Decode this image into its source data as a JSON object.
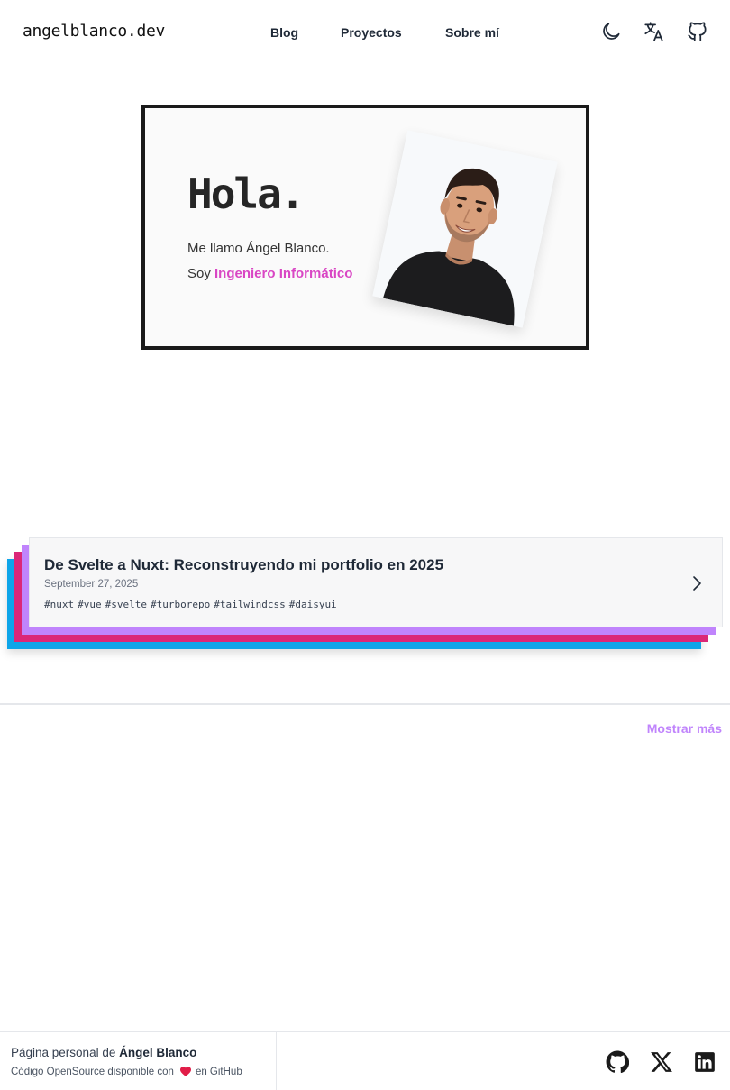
{
  "header": {
    "logo": "angelblanco.dev",
    "nav": [
      "Blog",
      "Proyectos",
      "Sobre mí"
    ],
    "icons": [
      "moon-icon",
      "translate-icon",
      "github-icon"
    ]
  },
  "hero": {
    "title": "Hola.",
    "line1": "Me llamo Ángel Blanco.",
    "line2_prefix": "Soy ",
    "role": "Ingeniero Informático",
    "accent_color": "#d946c4"
  },
  "post": {
    "title": "De Svelte a Nuxt: Reconstruyendo mi portfolio en 2025",
    "date": "September 27, 2025",
    "tags": [
      "#nuxt",
      "#vue",
      "#svelte",
      "#turborepo",
      "#tailwindcss",
      "#daisyui"
    ],
    "stack_colors": [
      "#c084fc",
      "#db2777",
      "#0ea5e9"
    ]
  },
  "show_more": "Mostrar más",
  "footer": {
    "prefix": "Página personal de ",
    "name": "Ángel Blanco",
    "code_text": "Código OpenSource disponible con",
    "code_suffix": "en GitHub",
    "social_icons": [
      "github-icon",
      "x-icon",
      "linkedin-icon"
    ]
  }
}
